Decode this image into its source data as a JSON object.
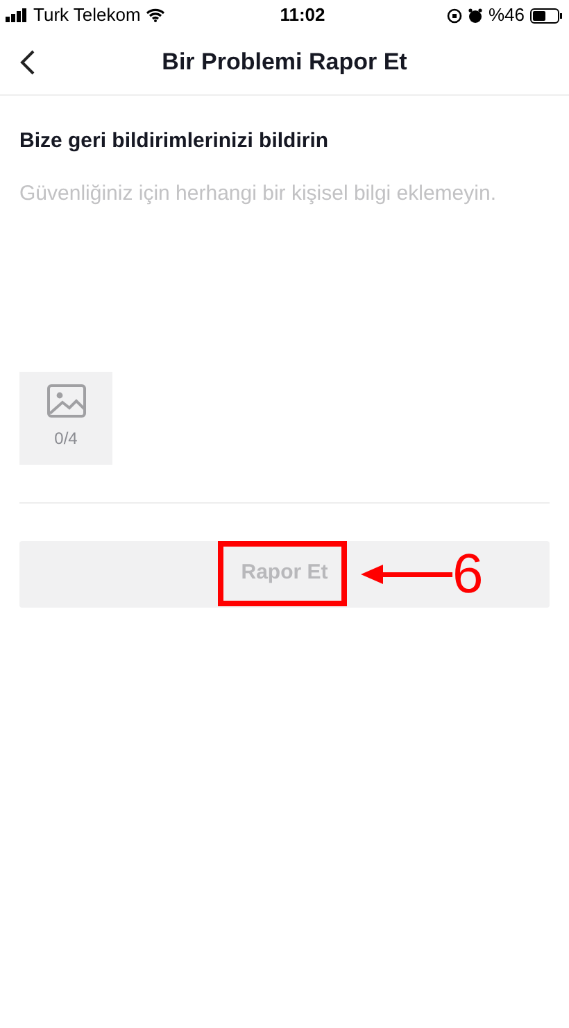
{
  "status_bar": {
    "carrier": "Turk Telekom",
    "time": "11:02",
    "battery": "%46"
  },
  "header": {
    "title": "Bir Problemi Rapor Et"
  },
  "form": {
    "heading": "Bize geri bildirimlerinizi bildirin",
    "placeholder": "Güvenliğiniz için herhangi bir kişisel bilgi eklemeyin.",
    "photo_count": "0/4"
  },
  "submit": {
    "label": "Rapor Et",
    "disabled": true
  },
  "annotation": {
    "label": "6"
  }
}
